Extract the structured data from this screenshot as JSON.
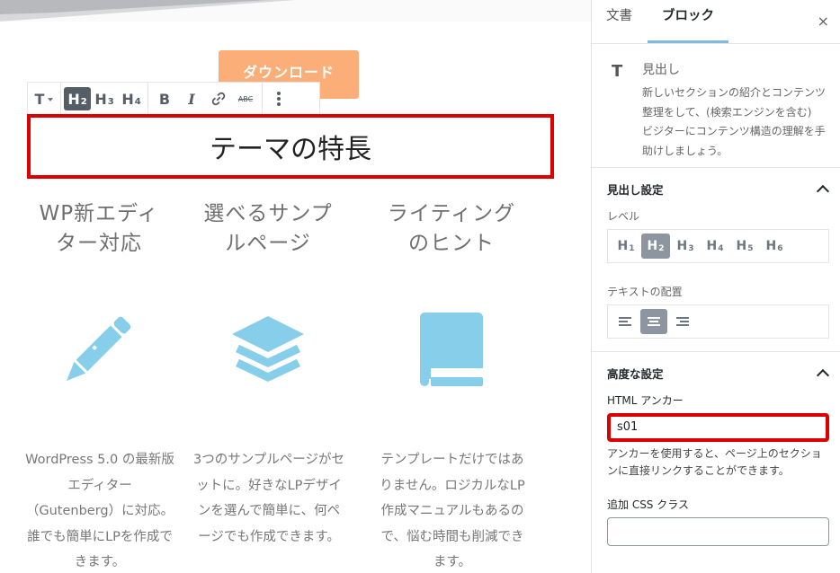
{
  "editor": {
    "download_button": "ダウンロード",
    "toolbar": {
      "paragraph_label": "T",
      "h2_label": "H",
      "h2_sub": "2",
      "h3_label": "H",
      "h3_sub": "3",
      "h4_label": "H",
      "h4_sub": "4",
      "bold_label": "B",
      "italic_label": "I",
      "strike_label": "ABC"
    },
    "heading_text": "テーマの特長",
    "features": [
      {
        "title_line1": "WP新エディ",
        "title_line2": "ター対応",
        "icon": "pencil-icon",
        "desc": "WordPress 5.0 の最新版エディター（Gutenberg）に対応。誰でも簡単にLPを作成できます。"
      },
      {
        "title_line1": "選べるサンプ",
        "title_line2": "ルページ",
        "icon": "layers-icon",
        "desc": "3つのサンプルページがセットに。好きなLPデザインを選んで簡単に、何ページでも作成できます。"
      },
      {
        "title_line1": "ライティング",
        "title_line2": "のヒント",
        "icon": "book-icon",
        "desc": "テンプレートだけではありません。ロジカルなLP作成マニュアルもあるので、悩む時間も削減できます。"
      }
    ],
    "icon_color": "#86ceea",
    "accent_orange": "#fcae78"
  },
  "sidebar": {
    "tabs": [
      "文書",
      "ブロック"
    ],
    "active_tab": "ブロック",
    "close_label": "×",
    "block": {
      "icon_label": "T",
      "name": "見出し",
      "description": "新しいセクションの紹介とコンテンツ整理をして、(検索エンジンを含む) ビジターにコンテンツ構造の理解を手助けしましょう。"
    },
    "heading_settings": {
      "title": "見出し設定",
      "level_label": "レベル",
      "levels": [
        {
          "h": "H",
          "n": "1"
        },
        {
          "h": "H",
          "n": "2"
        },
        {
          "h": "H",
          "n": "3"
        },
        {
          "h": "H",
          "n": "4"
        },
        {
          "h": "H",
          "n": "5"
        },
        {
          "h": "H",
          "n": "6"
        }
      ],
      "active_level": "2",
      "align_label": "テキストの配置",
      "active_align": "center"
    },
    "advanced": {
      "title": "高度な設定",
      "anchor_label": "HTML アンカー",
      "anchor_value": "s01",
      "anchor_help": "アンカーを使用すると、ページ上のセクションに直接リンクすることができます。",
      "css_label": "追加 CSS クラス",
      "css_value": ""
    }
  },
  "highlight_color": "#dd0000"
}
